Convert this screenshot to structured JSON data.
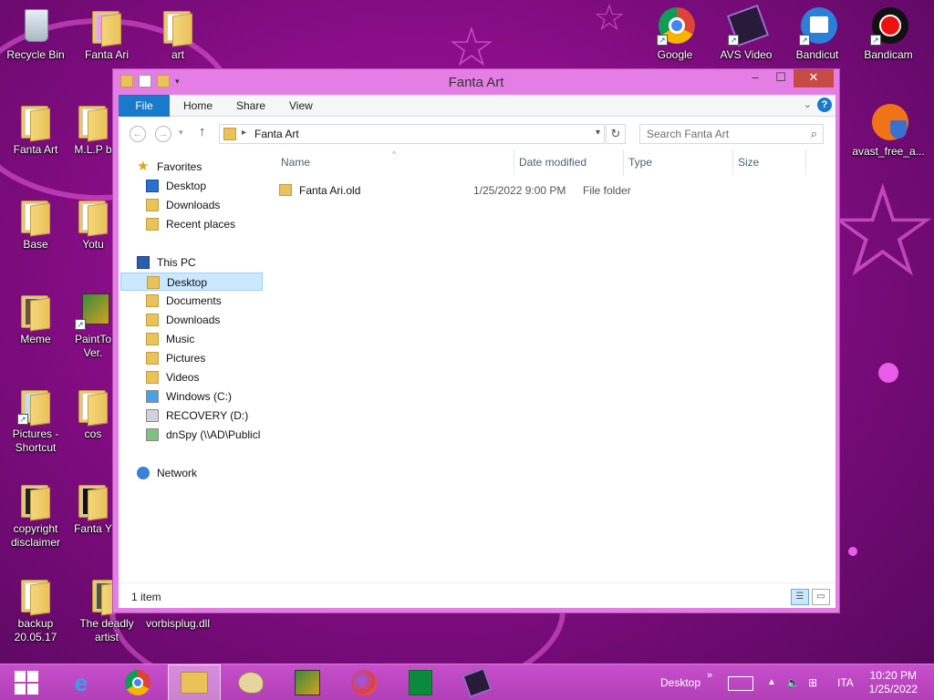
{
  "desktop": {
    "icons_left": [
      {
        "label": "Recycle Bin"
      },
      {
        "label": "Fanta Ari"
      },
      {
        "label": "art"
      },
      {
        "label": "Fanta Art"
      },
      {
        "label": "M.L.P b"
      },
      {
        "label": "Base"
      },
      {
        "label": "Yotu"
      },
      {
        "label": "Meme"
      },
      {
        "label": "PaintTo Ver."
      },
      {
        "label": "Pictures - Shortcut"
      },
      {
        "label": "cos"
      },
      {
        "label": "copyright disclaimer"
      },
      {
        "label": "Fanta Y"
      },
      {
        "label": "backup 20.05.17"
      },
      {
        "label": "The deadly artist"
      },
      {
        "label": "vorbisplug.dll"
      }
    ],
    "icons_right": [
      {
        "label": "Google",
        "icon": "chrome-icon"
      },
      {
        "label": "AVS Video",
        "icon": "avs-video-icon"
      },
      {
        "label": "Bandicut",
        "icon": "bandicut-icon"
      },
      {
        "label": "Bandicam",
        "icon": "bandicam-icon"
      },
      {
        "label": "avast_free_a...",
        "icon": "avast-icon"
      }
    ]
  },
  "window": {
    "title": "Fanta Art",
    "ribbon_tabs": [
      "File",
      "Home",
      "Share",
      "View"
    ],
    "address": "Fanta Art",
    "search_placeholder": "Search Fanta Art",
    "nav": {
      "favorites_label": "Favorites",
      "favorites": [
        "Desktop",
        "Downloads",
        "Recent places"
      ],
      "this_pc_label": "This PC",
      "this_pc": [
        "Desktop",
        "Documents",
        "Downloads",
        "Music",
        "Pictures",
        "Videos",
        "Windows (C:)",
        "RECOVERY (D:)",
        "dnSpy (\\\\AD\\Publicl"
      ],
      "network_label": "Network"
    },
    "columns": [
      "Name",
      "Date modified",
      "Type",
      "Size"
    ],
    "files": [
      {
        "name": "Fanta Ari.old",
        "date": "1/25/2022 9:00 PM",
        "type": "File folder",
        "size": ""
      }
    ],
    "status": "1 item"
  },
  "taskbar": {
    "tray_desktop": "Desktop",
    "tray_chevron": "»",
    "lang": "ITA",
    "time": "10:20 PM",
    "date": "1/25/2022"
  },
  "colors": {
    "accent": "#1979ca",
    "taskbar": "#b23fb8",
    "window_frame": "#e57ee4",
    "selection": "#cce8ff"
  }
}
